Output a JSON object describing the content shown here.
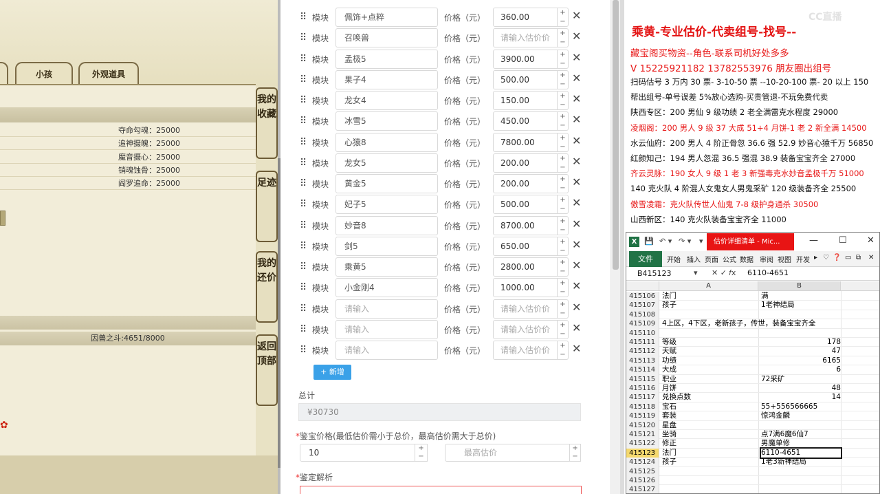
{
  "game": {
    "tabs": [
      "小孩",
      "外观道具"
    ],
    "rows": [
      "夺命勾魂：25000",
      "追神摄魄：25000",
      "魔音摄心：25000",
      "销魂蚀骨：25000",
      "阎罗追命：25000"
    ],
    "progress_text": "因兽之斗:4651/8000",
    "side_buttons": [
      "我的收藏",
      "足迹",
      "我的还价",
      "返回顶部"
    ]
  },
  "form": {
    "module_label": "模块",
    "price_label": "价格（元）",
    "items": [
      {
        "name": "佩饰+点粹",
        "price": "360.00"
      },
      {
        "name": "召唤兽",
        "price": ""
      },
      {
        "name": "孟极5",
        "price": "3900.00"
      },
      {
        "name": "果子4",
        "price": "500.00"
      },
      {
        "name": "龙女4",
        "price": "150.00"
      },
      {
        "name": "冰雪5",
        "price": "450.00"
      },
      {
        "name": "心猿8",
        "price": "7800.00"
      },
      {
        "name": "龙女5",
        "price": "200.00"
      },
      {
        "name": "黄金5",
        "price": "200.00"
      },
      {
        "name": "妃子5",
        "price": "500.00"
      },
      {
        "name": "妙音8",
        "price": "8700.00"
      },
      {
        "name": "剑5",
        "price": "650.00"
      },
      {
        "name": "乘黄5",
        "price": "2800.00"
      },
      {
        "name": "小金刚4",
        "price": "1000.00"
      },
      {
        "name": "",
        "price": ""
      },
      {
        "name": "",
        "price": ""
      },
      {
        "name": "",
        "price": ""
      }
    ],
    "name_placeholder": "请输入",
    "price_placeholder": "请输入估价价",
    "add_label": "+ 新增",
    "total_label": "总计",
    "total_value": "¥30730",
    "range_label": "鉴宝价格(最低估价需小于总价，最高估价需大于总价)",
    "min_value": "10",
    "max_placeholder": "最高估价",
    "analysis_label": "鉴定解析"
  },
  "doc": {
    "watermark": "CC直播",
    "title": "乘黄-专业估价-代卖组号-找号--",
    "lines": [
      {
        "text": "藏宝阁买物资--角色-联系司机好处多多",
        "red": true,
        "big": true
      },
      {
        "text": "V 15225921182   13782553976 朋友圈出组号",
        "red": true,
        "big": true
      },
      {
        "text": "扫码估号 3 万内 30 票- 3-10-50 票  --10-20-100 票- 20 以上 150",
        "red": false,
        "big": false
      },
      {
        "text": "帮出组号-单号误差 5%放心选购-买贵管退-不玩免费代卖",
        "red": false,
        "big": false
      },
      {
        "text": "陕西专区：200 男仙 9 级功绩 2 老全满雷克水程度 29000",
        "red": false,
        "big": false
      },
      {
        "text": "凌烟阁：200 男人 9 级 37 大成 51+4 月饼-1 老 2 新全满 14500",
        "red": true,
        "big": false
      },
      {
        "text": "水云仙府：200 男人 4 阶正骨忽 36.6 强 52.9 妙音心猿千万 56850",
        "red": false,
        "big": false
      },
      {
        "text": "红颜知己：194 男人忽混 36.5 强混 38.9 装备宝宝齐全 27000",
        "red": false,
        "big": false
      },
      {
        "text": "齐云灵脉：190 女人 9 级 1 老 3 新强毒克水妙音孟极千万 51000",
        "red": true,
        "big": false
      },
      {
        "text": "140 克火队 4 阶混人女鬼女人男鬼采矿 120 级装备齐全 25500",
        "red": false,
        "big": false
      },
      {
        "text": "傲雪凌霜：克火队传世人仙鬼 7-8 级护身通杀 30500",
        "red": true,
        "big": false
      },
      {
        "text": "山西新区：140 克火队装备宝宝齐全 11000",
        "red": false,
        "big": false
      }
    ]
  },
  "excel": {
    "doc_title": "估价详细清单 - Mic...",
    "file_tab": "文件",
    "ribbon_tabs": [
      "开始",
      "插入",
      "页面",
      "公式",
      "数据",
      "审阅",
      "视图",
      "开发"
    ],
    "namebox": "B415123",
    "formula_value": "6110-4651",
    "col_a": "A",
    "col_b": "B",
    "rows": [
      {
        "n": "415106",
        "a": "法门",
        "b": "满",
        "num": false
      },
      {
        "n": "415107",
        "a": "孩子",
        "b": "1老神结局",
        "num": false
      },
      {
        "n": "415108",
        "a": "",
        "b": "",
        "num": false
      },
      {
        "n": "415109",
        "a": "4上区，4下区，老新孩子，传世，装备宝宝齐全",
        "b": "",
        "num": false
      },
      {
        "n": "415110",
        "a": "",
        "b": "",
        "num": false
      },
      {
        "n": "415111",
        "a": "等级",
        "b": "178",
        "num": true
      },
      {
        "n": "415112",
        "a": "天赋",
        "b": "47",
        "num": true
      },
      {
        "n": "415113",
        "a": "功绩",
        "b": "6165",
        "num": true
      },
      {
        "n": "415114",
        "a": "大成",
        "b": "6",
        "num": true
      },
      {
        "n": "415115",
        "a": "职业",
        "b": "72采矿",
        "num": false
      },
      {
        "n": "415116",
        "a": "月饼",
        "b": "48",
        "num": true
      },
      {
        "n": "415117",
        "a": "兑换点数",
        "b": "14",
        "num": true
      },
      {
        "n": "415118",
        "a": "宝石",
        "b": "55+556566665",
        "num": false
      },
      {
        "n": "415119",
        "a": "套装",
        "b": "惊鸿金麟",
        "num": false
      },
      {
        "n": "415120",
        "a": "星盘",
        "b": "",
        "num": false
      },
      {
        "n": "415121",
        "a": "坐骑",
        "b": "点7满6魔6仙7",
        "num": false
      },
      {
        "n": "415122",
        "a": "修正",
        "b": "男魔单修",
        "num": false
      },
      {
        "n": "415123",
        "a": "法门",
        "b": "6110-4651",
        "num": false
      },
      {
        "n": "415124",
        "a": "孩子",
        "b": "1老3新神结局",
        "num": false
      },
      {
        "n": "415125",
        "a": "",
        "b": "",
        "num": false
      },
      {
        "n": "415126",
        "a": "",
        "b": "",
        "num": false
      },
      {
        "n": "415127",
        "a": "",
        "b": "",
        "num": false
      }
    ],
    "active_row": "415123"
  }
}
